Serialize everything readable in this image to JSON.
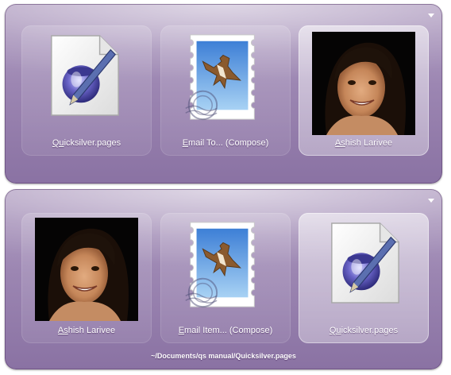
{
  "top_panel": {
    "items": [
      {
        "match": "Qu",
        "rest": "icksilver.pages",
        "icon": "pages-document-icon"
      },
      {
        "match": "E",
        "rest": "mail To... (Compose)",
        "icon": "mail-stamp-icon"
      },
      {
        "match": "As",
        "rest": "hish Larivee",
        "icon": "contact-photo"
      }
    ]
  },
  "bottom_panel": {
    "items": [
      {
        "match": "As",
        "rest": "hish Larivee",
        "icon": "contact-photo"
      },
      {
        "match": "E",
        "rest": "mail Item... (Compose)",
        "icon": "mail-stamp-icon"
      },
      {
        "match": "Qu",
        "rest": "icksilver.pages",
        "icon": "pages-document-icon"
      }
    ],
    "path_text": "~/Documents/qs manual/Quicksilver.pages"
  },
  "colors": {
    "panel_top": "#b7a6c6",
    "panel_bottom": "#8a72a3",
    "label_text": "#ffffff"
  }
}
